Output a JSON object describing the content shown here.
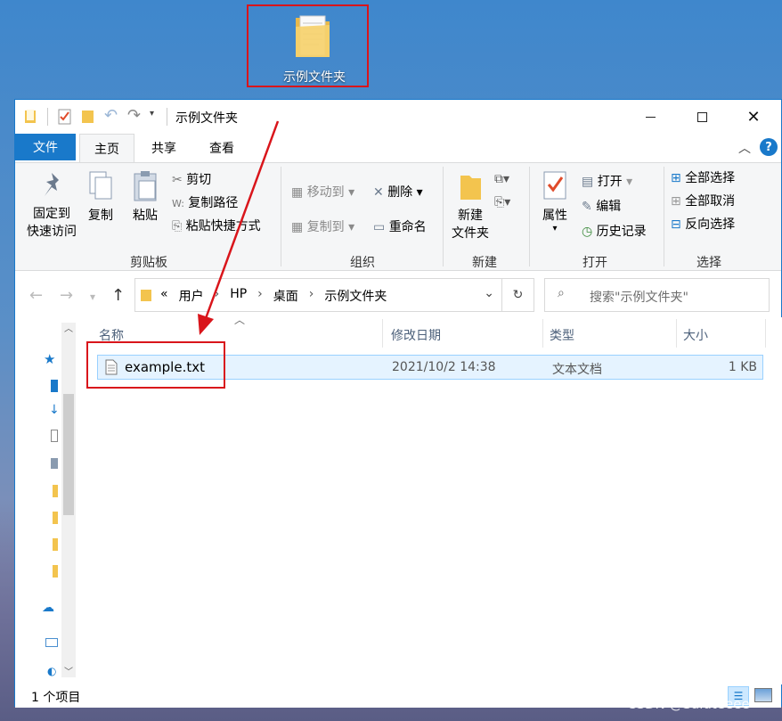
{
  "desktop": {
    "folder_label": "示例文件夹"
  },
  "window": {
    "title": "示例文件夹",
    "tabs": [
      "文件",
      "主页",
      "共享",
      "查看"
    ],
    "ribbon": {
      "pin_label": "固定到\n快速访问",
      "pin_line1": "固定到",
      "pin_line2": "快速访问",
      "copy": "复制",
      "paste": "粘贴",
      "cut": "剪切",
      "copy_path": "复制路径",
      "paste_shortcut": "粘贴快捷方式",
      "clipboard_group": "剪贴板",
      "move_to": "移动到",
      "copy_to": "复制到",
      "delete": "删除",
      "rename": "重命名",
      "organize_group": "组织",
      "new_folder_line1": "新建",
      "new_folder_line2": "文件夹",
      "new_group": "新建",
      "properties": "属性",
      "open": "打开",
      "edit": "编辑",
      "history": "历史记录",
      "open_group": "打开",
      "select_all": "全部选择",
      "select_none": "全部取消",
      "invert_selection": "反向选择",
      "select_group": "选择"
    },
    "address": {
      "prefix": "«",
      "parts": [
        "用户",
        "HP",
        "桌面",
        "示例文件夹"
      ]
    },
    "search_placeholder": "搜索\"示例文件夹\"",
    "columns": [
      "名称",
      "修改日期",
      "类型",
      "大小"
    ],
    "files": [
      {
        "name": "example.txt",
        "modified": "2021/10/2 14:38",
        "type": "文本文档",
        "size": "1 KB"
      }
    ],
    "status": "1 个项目"
  },
  "watermark": "CSDN @Saluteeee",
  "colors": {
    "accent": "#1979ca",
    "highlight": "#d9151b",
    "selected_row": "#e5f3ff"
  }
}
